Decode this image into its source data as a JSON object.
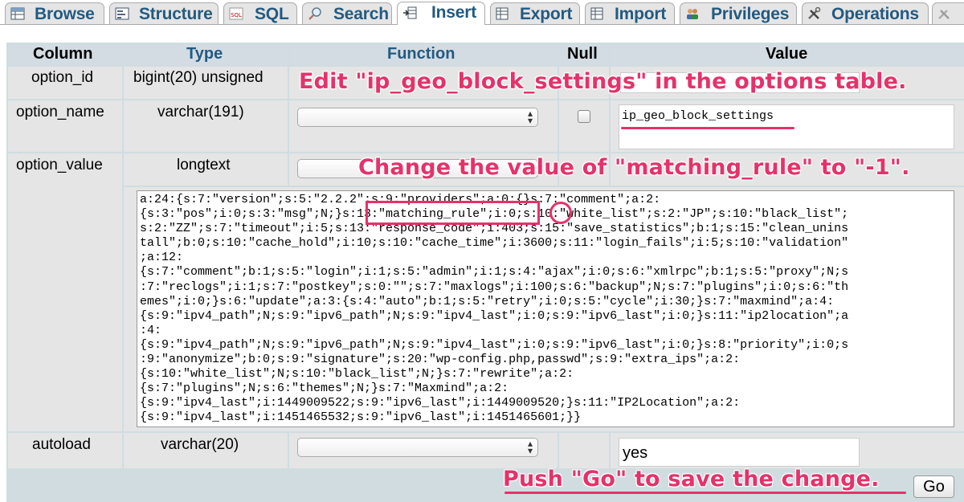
{
  "tabs": [
    {
      "label": "Browse",
      "icon": "browse-icon"
    },
    {
      "label": "Structure",
      "icon": "structure-icon"
    },
    {
      "label": "SQL",
      "icon": "sql-icon"
    },
    {
      "label": "Search",
      "icon": "search-icon"
    },
    {
      "label": "Insert",
      "icon": "insert-icon",
      "active": true
    },
    {
      "label": "Export",
      "icon": "export-icon"
    },
    {
      "label": "Import",
      "icon": "import-icon"
    },
    {
      "label": "Privileges",
      "icon": "privileges-icon"
    },
    {
      "label": "Operations",
      "icon": "operations-icon"
    },
    {
      "label": "",
      "icon": "more-icon"
    }
  ],
  "table": {
    "headers": {
      "column": "Column",
      "type": "Type",
      "function": "Function",
      "null": "Null",
      "value": "Value"
    },
    "rows": [
      {
        "column": "option_id",
        "type": "bigint(20) unsigned",
        "value": ""
      },
      {
        "column": "option_name",
        "type": "varchar(191)",
        "value": "ip_geo_block_settings"
      },
      {
        "column": "option_value",
        "type": "longtext",
        "value_lines": [
          "a:24:{s:7:\"version\";s:5:\"2.2.2\";s:9:\"providers\";a:0:{}s:7:\"comment\";a:2:",
          "{s:3:\"pos\";i:0;s:3:\"msg\";N;}s:13:\"matching_rule\";i:0;s:10:\"white_list\";s:2:\"JP\";s:10:\"black_list\";",
          "s:2:\"ZZ\";s:7:\"timeout\";i:5;s:13:\"response_code\";i:403;s:15:\"save_statistics\";b:1;s:15:\"clean_unins",
          "tall\";b:0;s:10:\"cache_hold\";i:10;s:10:\"cache_time\";i:3600;s:11:\"login_fails\";i:5;s:10:\"validation\"",
          ";a:12:",
          "{s:7:\"comment\";b:1;s:5:\"login\";i:1;s:5:\"admin\";i:1;s:4:\"ajax\";i:0;s:6:\"xmlrpc\";b:1;s:5:\"proxy\";N;s",
          ":7:\"reclogs\";i:1;s:7:\"postkey\";s:0:\"\";s:7:\"maxlogs\";i:100;s:6:\"backup\";N;s:7:\"plugins\";i:0;s:6:\"th",
          "emes\";i:0;}s:6:\"update\";a:3:{s:4:\"auto\";b:1;s:5:\"retry\";i:0;s:5:\"cycle\";i:30;}s:7:\"maxmind\";a:4:",
          "{s:9:\"ipv4_path\";N;s:9:\"ipv6_path\";N;s:9:\"ipv4_last\";i:0;s:9:\"ipv6_last\";i:0;}s:11:\"ip2location\";a",
          ":4:",
          "{s:9:\"ipv4_path\";N;s:9:\"ipv6_path\";N;s:9:\"ipv4_last\";i:0;s:9:\"ipv6_last\";i:0;}s:8:\"priority\";i:0;s",
          ":9:\"anonymize\";b:0;s:9:\"signature\";s:20:\"wp-config.php,passwd\";s:9:\"extra_ips\";a:2:",
          "{s:10:\"white_list\";N;s:10:\"black_list\";N;}s:7:\"rewrite\";a:2:",
          "{s:7:\"plugins\";N;s:6:\"themes\";N;}s:7:\"Maxmind\";a:2:",
          "{s:9:\"ipv4_last\";i:1449009522;s:9:\"ipv6_last\";i:1449009520;}s:11:\"IP2Location\";a:2:",
          "{s:9:\"ipv4_last\";i:1451465532;s:9:\"ipv6_last\";i:1451465601;}}"
        ]
      },
      {
        "column": "autoload",
        "type": "varchar(20)",
        "value": "yes"
      }
    ]
  },
  "go_button": "Go",
  "annotations": {
    "edit": "Edit \"ip_geo_block_settings\" in the options table.",
    "change": "Change the value of \"matching_rule\" to \"-1\".",
    "push": "Push \"Go\" to save the change."
  },
  "colors": {
    "accent": "#e5326a",
    "tab_text": "#235a81",
    "header_bg": "#d3dce3",
    "cell_bg": "#e5e5e5"
  }
}
